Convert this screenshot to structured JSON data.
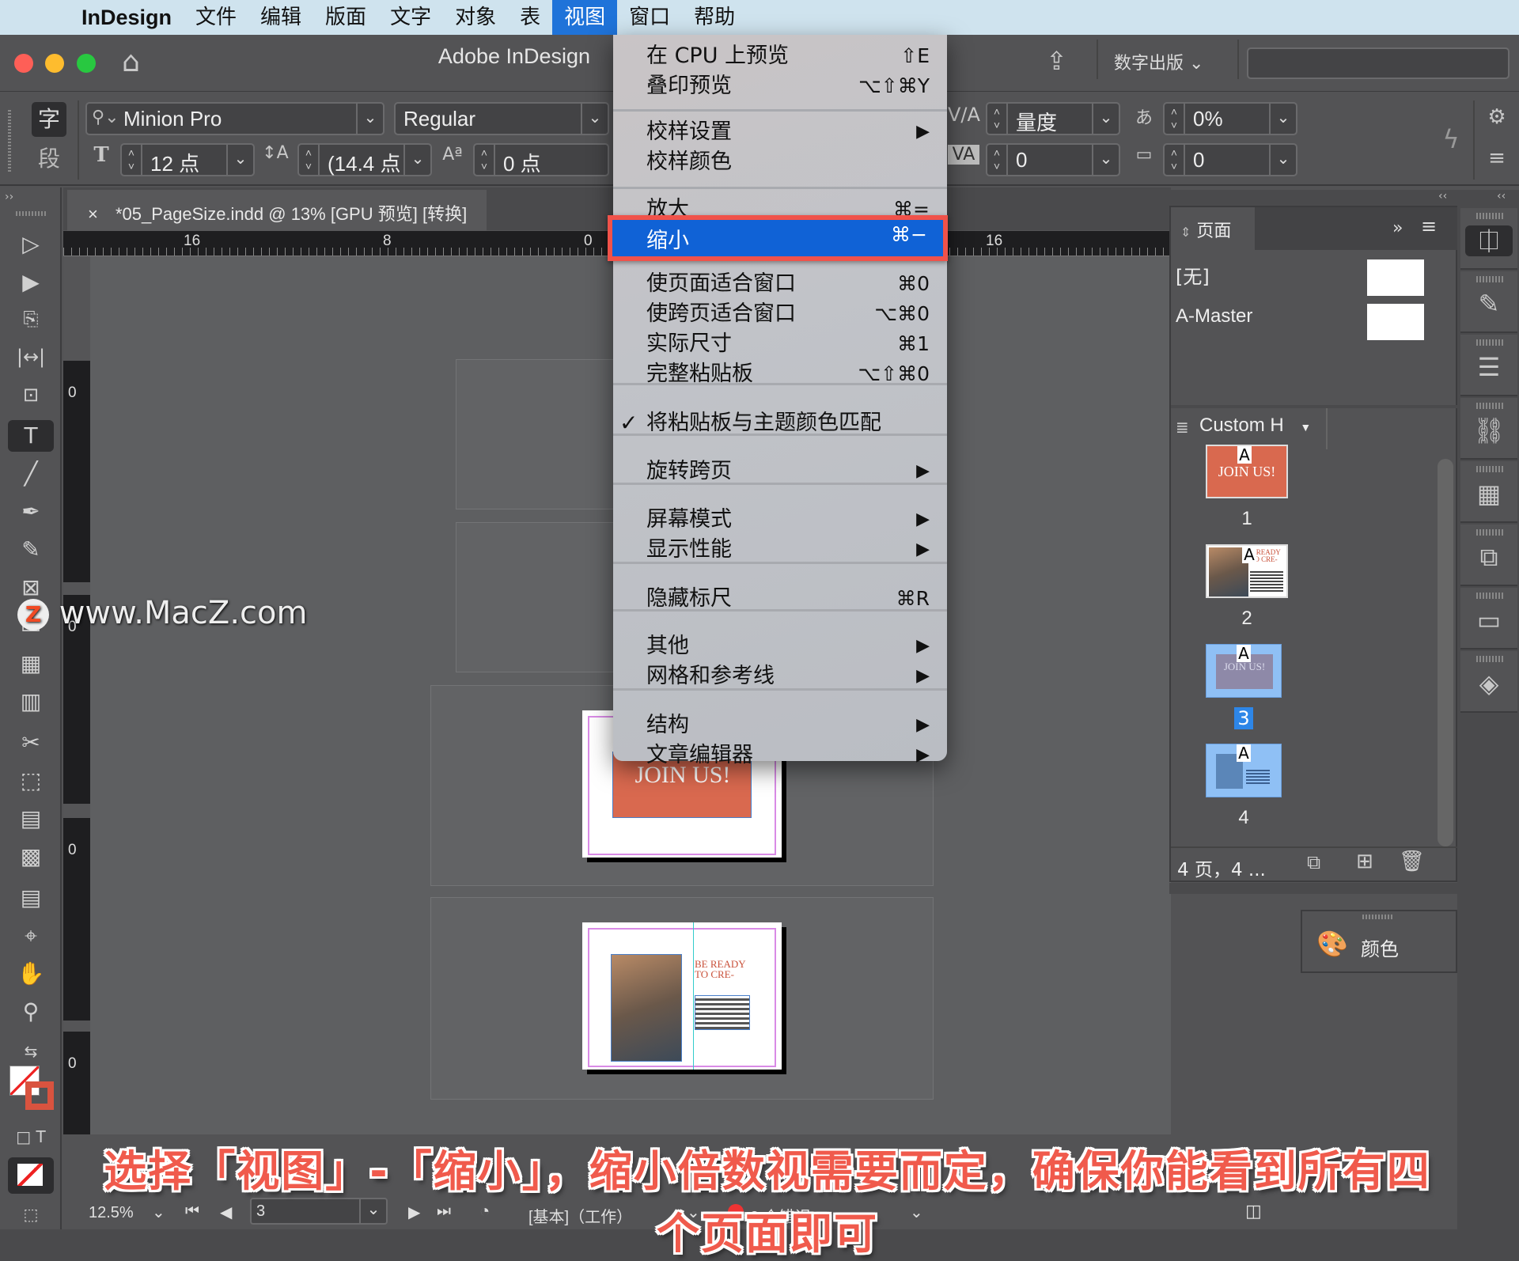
{
  "menubar": {
    "apple": "",
    "app": "InDesign",
    "items": [
      "文件",
      "编辑",
      "版面",
      "文字",
      "对象",
      "表",
      "视图",
      "窗口",
      "帮助"
    ],
    "active": "视图"
  },
  "window": {
    "title": "Adobe InDesign",
    "workspace": "数字出版",
    "search_placeholder": ""
  },
  "control": {
    "char_tab": "字",
    "para_tab": "段",
    "font_family": "Minion Pro",
    "font_style": "Regular",
    "font_size": "12 点",
    "leading": "(14.4 点",
    "baseline_shift": "0 点",
    "kerning": "量度",
    "tracking": "0",
    "tsume": "0%",
    "grid_spacing": "0"
  },
  "document": {
    "tab_title": "*05_PageSize.indd @ 13% [GPU 预览] [转换]",
    "close": "×",
    "hruler_labels": [
      "16",
      "8",
      "0",
      "16"
    ],
    "vruler_labels": [
      "0",
      "0",
      "0",
      "0"
    ],
    "page1_text": "JOIN US!",
    "page2_text_line1": "BE READY",
    "page2_text_line2": "TO CRE-"
  },
  "view_menu": {
    "items": [
      {
        "label": "在 CPU 上预览",
        "shortcut": "⇧E"
      },
      {
        "label": "叠印预览",
        "shortcut": "⌥⇧⌘Y"
      },
      {
        "label": "校样设置",
        "submenu": true
      },
      {
        "label": "校样颜色"
      },
      {
        "label": "放大",
        "shortcut": "⌘="
      },
      {
        "label": "缩小",
        "shortcut": "⌘−",
        "highlighted": true
      },
      {
        "label": "使页面适合窗口",
        "shortcut": "⌘0"
      },
      {
        "label": "使跨页适合窗口",
        "shortcut": "⌥⌘0"
      },
      {
        "label": "实际尺寸",
        "shortcut": "⌘1"
      },
      {
        "label": "完整粘贴板",
        "shortcut": "⌥⇧⌘0"
      },
      {
        "label": "将粘贴板与主题颜色匹配",
        "checked": true
      },
      {
        "label": "旋转跨页",
        "submenu": true
      },
      {
        "label": "屏幕模式",
        "submenu": true
      },
      {
        "label": "显示性能",
        "submenu": true
      },
      {
        "label": "隐藏标尺",
        "shortcut": "⌘R"
      },
      {
        "label": "其他",
        "submenu": true
      },
      {
        "label": "网格和参考线",
        "submenu": true
      },
      {
        "label": "结构",
        "submenu": true
      },
      {
        "label": "文章编辑器",
        "submenu": true
      }
    ],
    "check": "✓",
    "arrow": "▶"
  },
  "pages_panel": {
    "title": "页面",
    "masters": [
      "[无]",
      "A-Master"
    ],
    "size_label": "Custom H",
    "pages": [
      {
        "num": "1",
        "master": "A",
        "selected": false
      },
      {
        "num": "2",
        "master": "A",
        "selected": false
      },
      {
        "num": "3",
        "master": "A",
        "selected": true
      },
      {
        "num": "4",
        "master": "A",
        "selected": false
      }
    ],
    "footer": "4 页，4 ...",
    "color_panel": "颜色"
  },
  "statusbar": {
    "zoom": "12.5%",
    "page": "3",
    "profile": "[基本]（工作）",
    "errors": "2 个错误"
  },
  "colors": {
    "menu_highlight": "#1062d6",
    "callout_border": "#f0524a",
    "selected_page": "#8fc0f5",
    "page1_accent": "#d9694f",
    "error_dot": "#ee3333"
  },
  "caption": "选择「视图」-「缩小」，缩小倍数视需要而定，确保你能看到所有四个页面即可",
  "watermark": "www.MacZ.com"
}
